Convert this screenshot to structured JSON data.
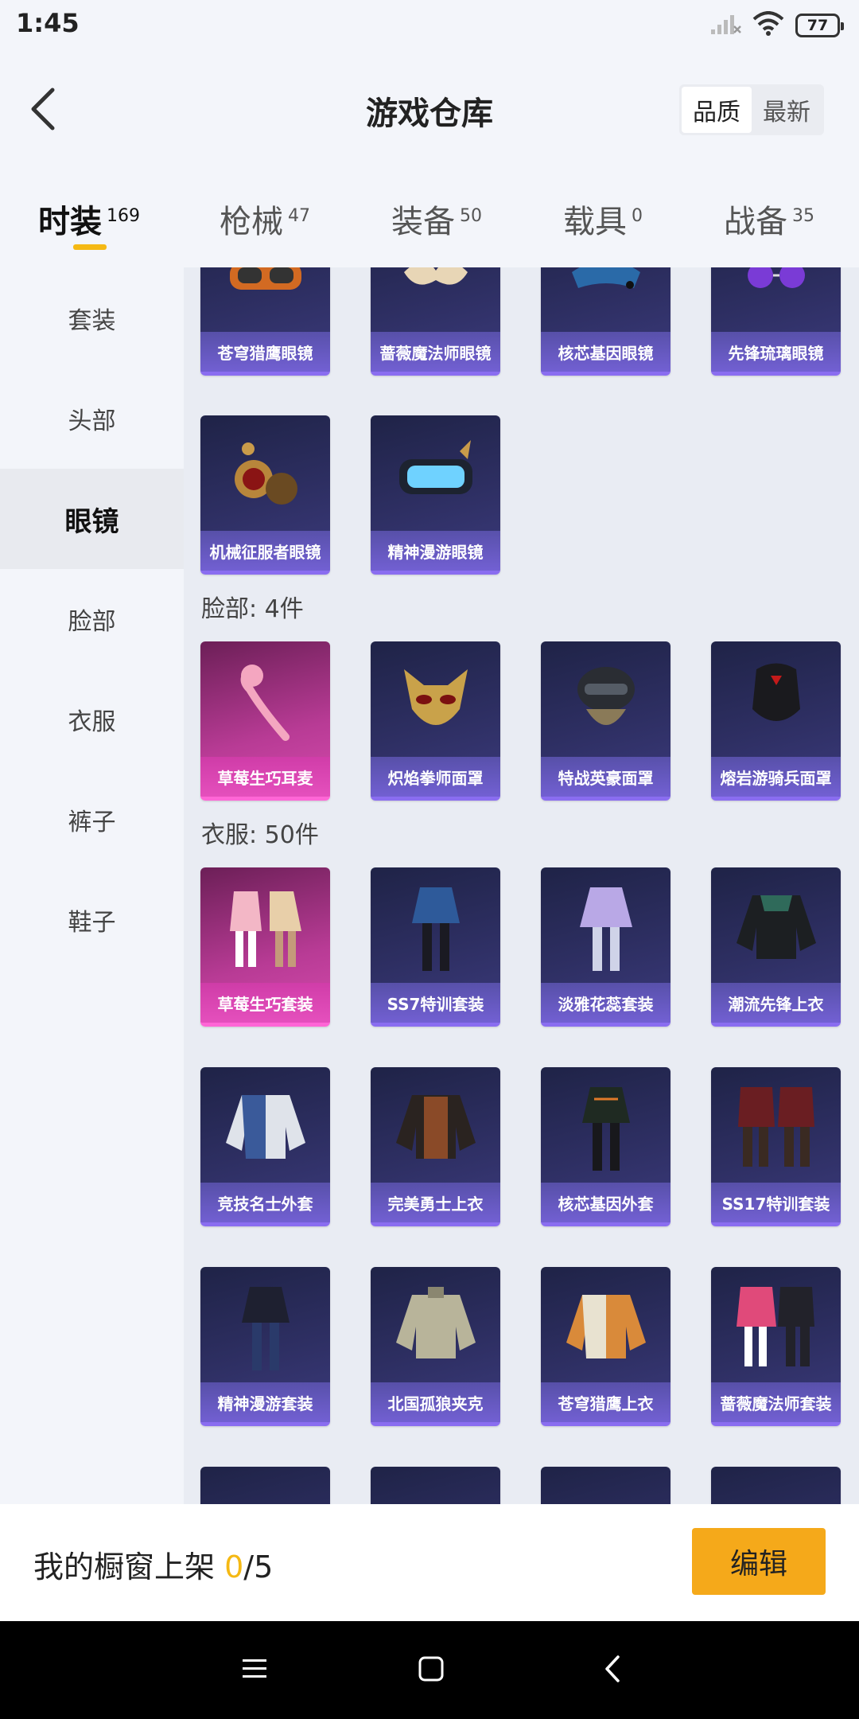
{
  "status_bar": {
    "time": "1:45",
    "battery": "77"
  },
  "header": {
    "title": "游戏仓库",
    "sort_options": [
      "品质",
      "最新"
    ],
    "sort_active": "品质"
  },
  "categories": [
    {
      "label": "时装",
      "count": "169",
      "active": true
    },
    {
      "label": "枪械",
      "count": "47",
      "active": false
    },
    {
      "label": "装备",
      "count": "50",
      "active": false
    },
    {
      "label": "载具",
      "count": "0",
      "active": false
    },
    {
      "label": "战备",
      "count": "35",
      "active": false
    }
  ],
  "sidebar": [
    {
      "label": "套装"
    },
    {
      "label": "头部"
    },
    {
      "label": "眼镜"
    },
    {
      "label": "脸部"
    },
    {
      "label": "衣服"
    },
    {
      "label": "裤子"
    },
    {
      "label": "鞋子"
    }
  ],
  "sidebar_active": "眼镜",
  "sections": {
    "face": "脸部: 4件",
    "clothes": "衣服: 50件"
  },
  "items": {
    "glasses_row1": [
      "苍穹猎鹰眼镜",
      "蔷薇魔法师眼镜",
      "核芯基因眼镜",
      "先锋琉璃眼镜"
    ],
    "glasses_row2": [
      "机械征服者眼镜",
      "精神漫游眼镜"
    ],
    "face": [
      "草莓生巧耳麦",
      "炽焰拳师面罩",
      "特战英豪面罩",
      "熔岩游骑兵面罩"
    ],
    "clothes_row1": [
      "草莓生巧套装",
      "SS7特训套装",
      "淡雅花蕊套装",
      "潮流先锋上衣"
    ],
    "clothes_row2": [
      "竞技名士外套",
      "完美勇士上衣",
      "核芯基因外套",
      "SS17特训套装"
    ],
    "clothes_row3": [
      "精神漫游套装",
      "北国孤狼夹克",
      "苍穹猎鹰上衣",
      "蔷薇魔法师套装"
    ]
  },
  "footer": {
    "label": "我的橱窗上架 ",
    "current": "0",
    "total": "/5",
    "edit_label": "编辑"
  },
  "colors": {
    "accent": "#f5b914",
    "card_purple": "#2e2f63",
    "card_pink": "#b83b95",
    "edit_button": "#f5a91a"
  },
  "icons": [
    "back-arrow-icon",
    "signal-icon",
    "wifi-icon",
    "battery-icon",
    "menu-icon",
    "home-square-icon",
    "nav-back-icon"
  ]
}
